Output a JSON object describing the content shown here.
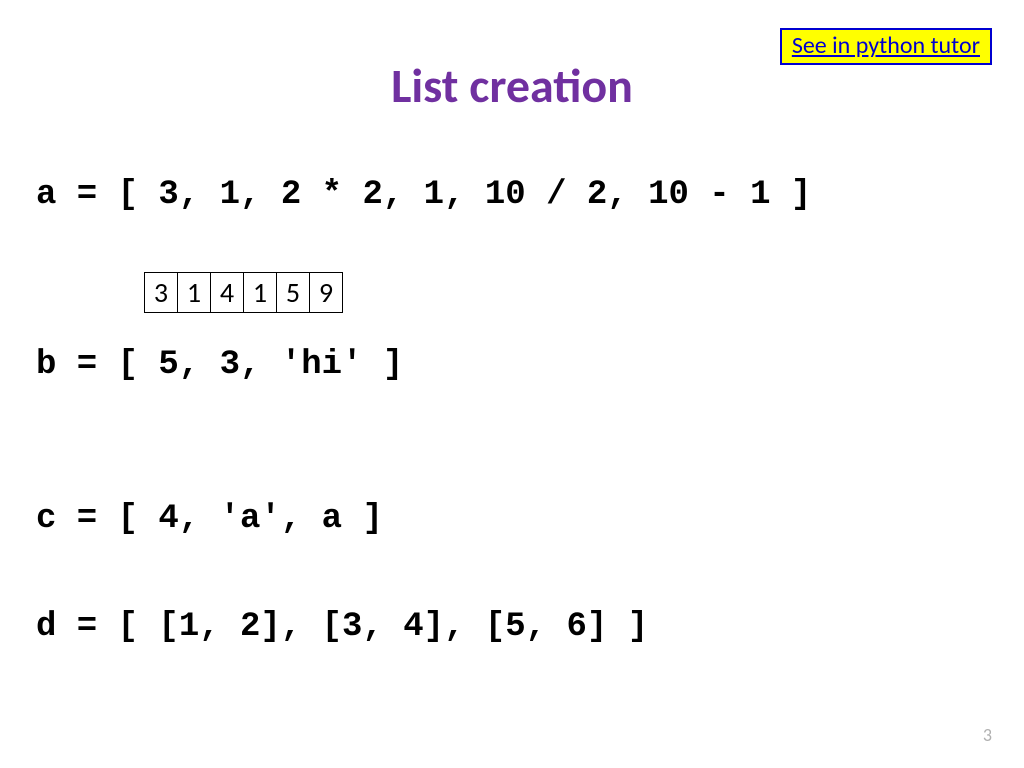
{
  "link": {
    "label": "See in python tutor"
  },
  "title": "List creation",
  "code": {
    "a": "a = [ 3, 1, 2 * 2, 1, 10 / 2, 10 - 1 ]",
    "b": "b = [ 5, 3, 'hi' ]",
    "c": "c = [ 4, 'a', a ]",
    "d": "d = [ [1, 2], [3, 4], [5, 6] ]"
  },
  "array": [
    "3",
    "1",
    "4",
    "1",
    "5",
    "9"
  ],
  "page_number": "3"
}
